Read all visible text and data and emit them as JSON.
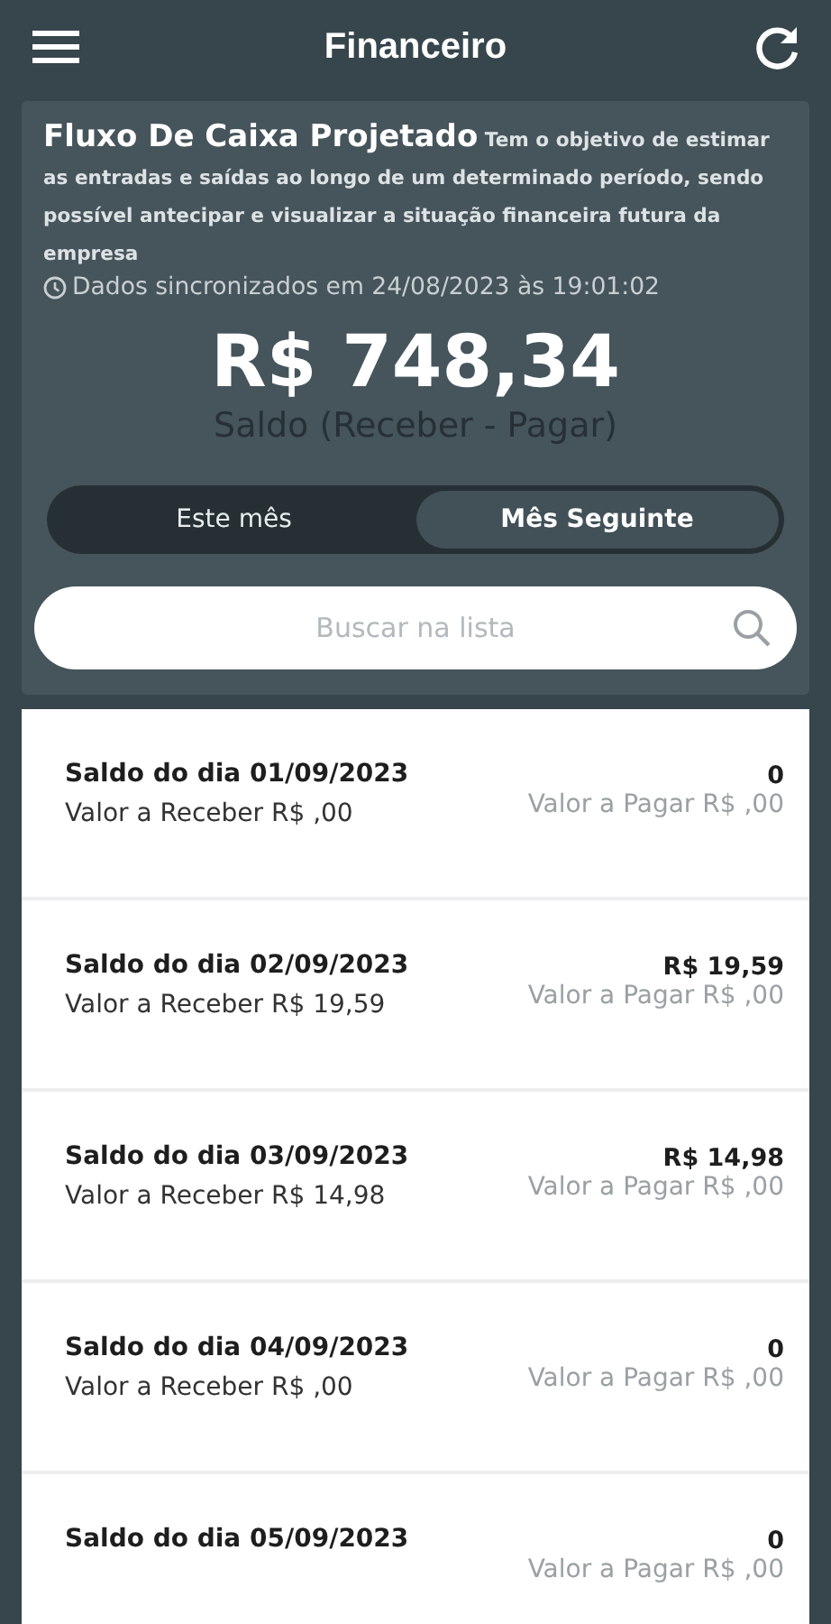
{
  "header": {
    "title": "Financeiro"
  },
  "summary": {
    "title": "Fluxo De Caixa Projetado",
    "description": "Tem o objetivo de estimar as entradas e saídas ao longo de um determinado período, sendo possível antecipar e visualizar a situação financeira futura da empresa",
    "sync": "Dados sincronizados em 24/08/2023 às 19:01:02",
    "balance": "R$ 748,34",
    "balance_label": "Saldo (Receber - Pagar)"
  },
  "tabs": [
    {
      "label": "Este mês",
      "selected": false
    },
    {
      "label": "Mês Seguinte",
      "selected": true
    }
  ],
  "search": {
    "placeholder": "Buscar na lista"
  },
  "rows": [
    {
      "title": "Saldo do dia 01/09/2023",
      "receive": "Valor a Receber R$ ,00",
      "balance": "0",
      "pay": "Valor a Pagar R$ ,00"
    },
    {
      "title": "Saldo do dia 02/09/2023",
      "receive": "Valor a Receber R$ 19,59",
      "balance": "R$ 19,59",
      "pay": "Valor a Pagar R$ ,00"
    },
    {
      "title": "Saldo do dia 03/09/2023",
      "receive": "Valor a Receber R$ 14,98",
      "balance": "R$ 14,98",
      "pay": "Valor a Pagar R$ ,00"
    },
    {
      "title": "Saldo do dia 04/09/2023",
      "receive": "Valor a Receber R$ ,00",
      "balance": "0",
      "pay": "Valor a Pagar R$ ,00"
    },
    {
      "title": "Saldo do dia 05/09/2023",
      "balance": "0",
      "pay": "Valor a Pagar R$ ,00"
    }
  ]
}
